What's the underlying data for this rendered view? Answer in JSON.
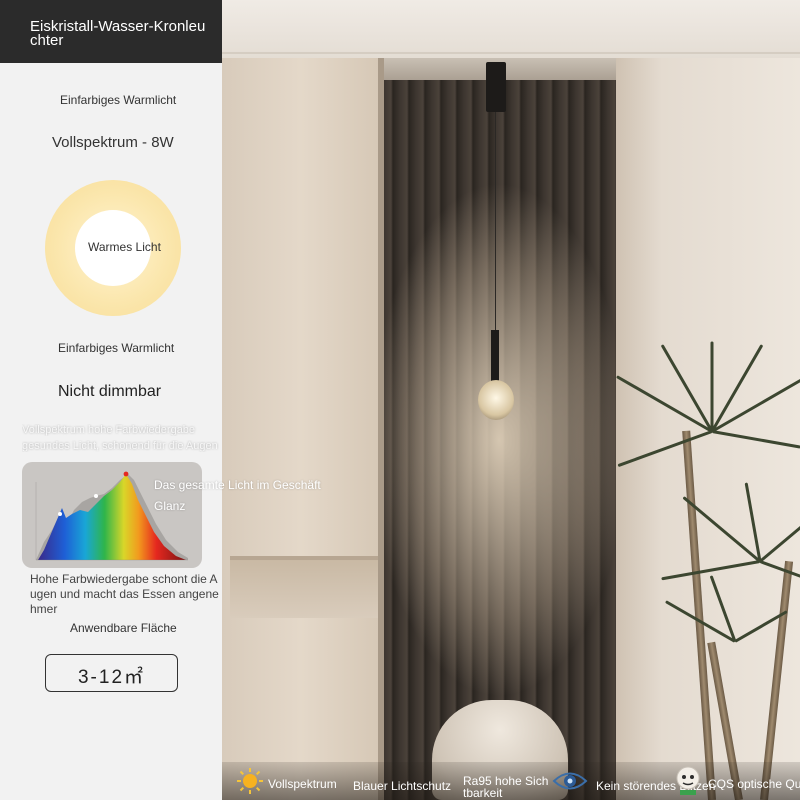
{
  "panel": {
    "title": "Eiskristall-Wasser-Kronleuchter",
    "light_type_top": "Einfarbiges Warmlicht",
    "spectrum_power": "Vollspektrum - 8W",
    "warm_light_label": "Warmes Licht",
    "light_type_mid": "Einfarbiges Warmlicht",
    "dimmable": "Nicht dimmbar",
    "ghost_line_1": "Vollspektrum hohe Farbwiedergabe",
    "ghost_line_2": "gesundes Licht, schonend für die Augen",
    "color_rendering_note": "Hohe Farbwiedergabe schont die Augen und macht das Essen angenehmer",
    "applicable_area_label": "Anwendbare Fläche",
    "applicable_area_value": "3-12㎡"
  },
  "spectrum_overlay": {
    "line_1": "Das gesamte Licht im Geschäft",
    "line_2": "Glanz"
  },
  "features": [
    {
      "icon": "sun-icon",
      "label": "Vollspektrum"
    },
    {
      "icon": "shield-icon",
      "label": "Blauer Lichtschutz"
    },
    {
      "icon": "eye-icon",
      "label": "Ra95 hohe Sichtbarkeit"
    },
    {
      "icon": "no-flicker-eye-icon",
      "label": "Kein störendes Blitzen"
    },
    {
      "icon": "cqs-badge-icon",
      "label": "CQS optische Qualität"
    }
  ],
  "colors": {
    "header_bg": "#2b2b2b",
    "panel_bg": "#f2f2f2",
    "warm_ring": "#f7dc96"
  }
}
